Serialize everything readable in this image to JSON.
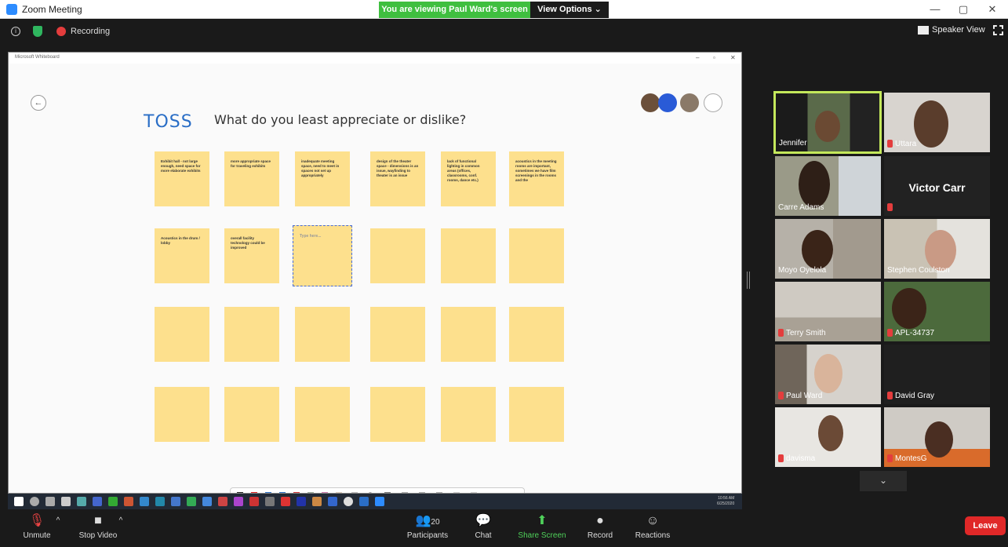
{
  "window": {
    "title": "Zoom Meeting",
    "controls": [
      "—",
      "▢",
      "✕"
    ]
  },
  "banner": {
    "viewing": "You are viewing Paul Ward's screen",
    "view_options": "View Options ⌄"
  },
  "topbar": {
    "recording_label": "Recording",
    "speaker_view": "Speaker View"
  },
  "shared": {
    "app_title": "Microsoft Whiteboard",
    "heading_tag": "TOSS",
    "question": "What do you least appreciate or dislike?",
    "notes": [
      "Exhibit hall - not large enough, need space for more elaborate exhibits",
      "more appropriate space for traveling exhibits",
      "inadequate meeting space, need to meet in spaces not set up appropriately",
      "design of the theater space - dimensions is an issue, wayfinding to theater is an issue",
      "lack of functional lighting in common areas (offices, classrooms, conf. rooms, dance etc.)",
      "acoustics in the meeting rooms are important, sometimes we have film screenings in the rooms and the",
      "Acoustics in the drum / lobby",
      "overall facility technology could be improved"
    ],
    "placeholder": "Type here...",
    "taskbar_time": "10:56 AM",
    "taskbar_date": "6/25/2020"
  },
  "participants": [
    {
      "name": "Jennifer"
    },
    {
      "name": "Uttara"
    },
    {
      "name": "Carre Adams"
    },
    {
      "name": "Victor Carr"
    },
    {
      "name": "Moyo Oyelola"
    },
    {
      "name": "Stephen Coulston"
    },
    {
      "name": "Terry Smith"
    },
    {
      "name": "APL-34737"
    },
    {
      "name": "Paul Ward"
    },
    {
      "name": "David Gray"
    },
    {
      "name": "davisma"
    },
    {
      "name": "MontesG"
    }
  ],
  "controls": {
    "unmute": "Unmute",
    "stop_video": "Stop Video",
    "participants": "Participants",
    "participants_count": "20",
    "chat": "Chat",
    "share_screen": "Share Screen",
    "record": "Record",
    "reactions": "Reactions",
    "leave": "Leave"
  },
  "colors": {
    "banner_green": "#3fbf3f",
    "leave_red": "#e02828",
    "sticky_yellow": "#fde08d",
    "toss_blue": "#2a6ec6",
    "active_speaker": "#c4e85b"
  }
}
